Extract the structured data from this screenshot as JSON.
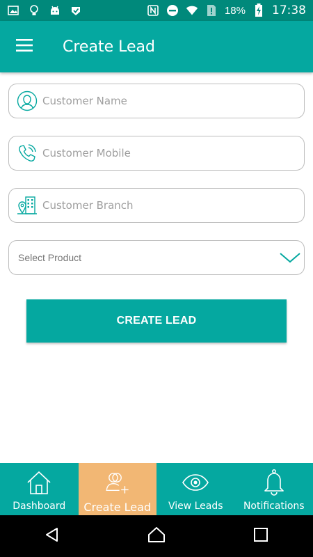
{
  "status_bar": {
    "battery": "18%",
    "time": "17:38"
  },
  "app_bar": {
    "title": "Create Lead"
  },
  "form": {
    "customer_name_placeholder": "Customer Name",
    "customer_mobile_placeholder": "Customer Mobile",
    "customer_branch_placeholder": "Customer Branch",
    "select_product_label": "Select Product"
  },
  "create_button_label": "CREATE LEAD",
  "bottom_nav": {
    "items": [
      {
        "label": "Dashboard",
        "icon": "home-icon"
      },
      {
        "label": "Create Lead",
        "icon": "add-user-icon",
        "active": true
      },
      {
        "label": "View Leads",
        "icon": "eye-icon"
      },
      {
        "label": "Notifications",
        "icon": "bell-icon"
      }
    ]
  },
  "colors": {
    "status_bar": "#00897b",
    "primary": "#05a8a0",
    "active_tab": "#f2b774",
    "icon_accent": "#05a8a0"
  }
}
